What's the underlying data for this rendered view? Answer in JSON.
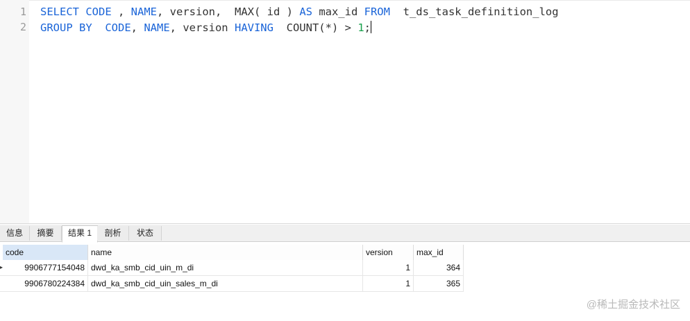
{
  "editor": {
    "line_numbers": [
      "1",
      "2"
    ],
    "line1": {
      "select": "SELECT",
      "code": "CODE",
      "comma1": " , ",
      "name": "NAME",
      "rest1": ", version,  MAX( id ) ",
      "as": "AS",
      "rest2": " max_id ",
      "from": "FROM",
      "table": "  t_ds_task_definition_log"
    },
    "line2": {
      "group_by": "GROUP BY",
      "sp1": "  ",
      "code": "CODE",
      "comma": ", ",
      "name": "NAME",
      "version": ", version ",
      "having": "HAVING",
      "count": "  COUNT(*) > ",
      "one": "1",
      "semi": ";"
    }
  },
  "tabs": [
    {
      "label": "信息"
    },
    {
      "label": "摘要"
    },
    {
      "label": "结果 1"
    },
    {
      "label": "剖析"
    },
    {
      "label": "状态"
    }
  ],
  "results": {
    "columns": [
      "code",
      "name",
      "version",
      "max_id"
    ],
    "rows": [
      {
        "code": "9906777154048",
        "name": "dwd_ka_smb_cid_uin_m_di",
        "version": "1",
        "max_id": "364"
      },
      {
        "code": "9906780224384",
        "name": "dwd_ka_smb_cid_uin_sales_m_di",
        "version": "1",
        "max_id": "365"
      }
    ]
  },
  "watermark": "@稀土掘金技术社区"
}
